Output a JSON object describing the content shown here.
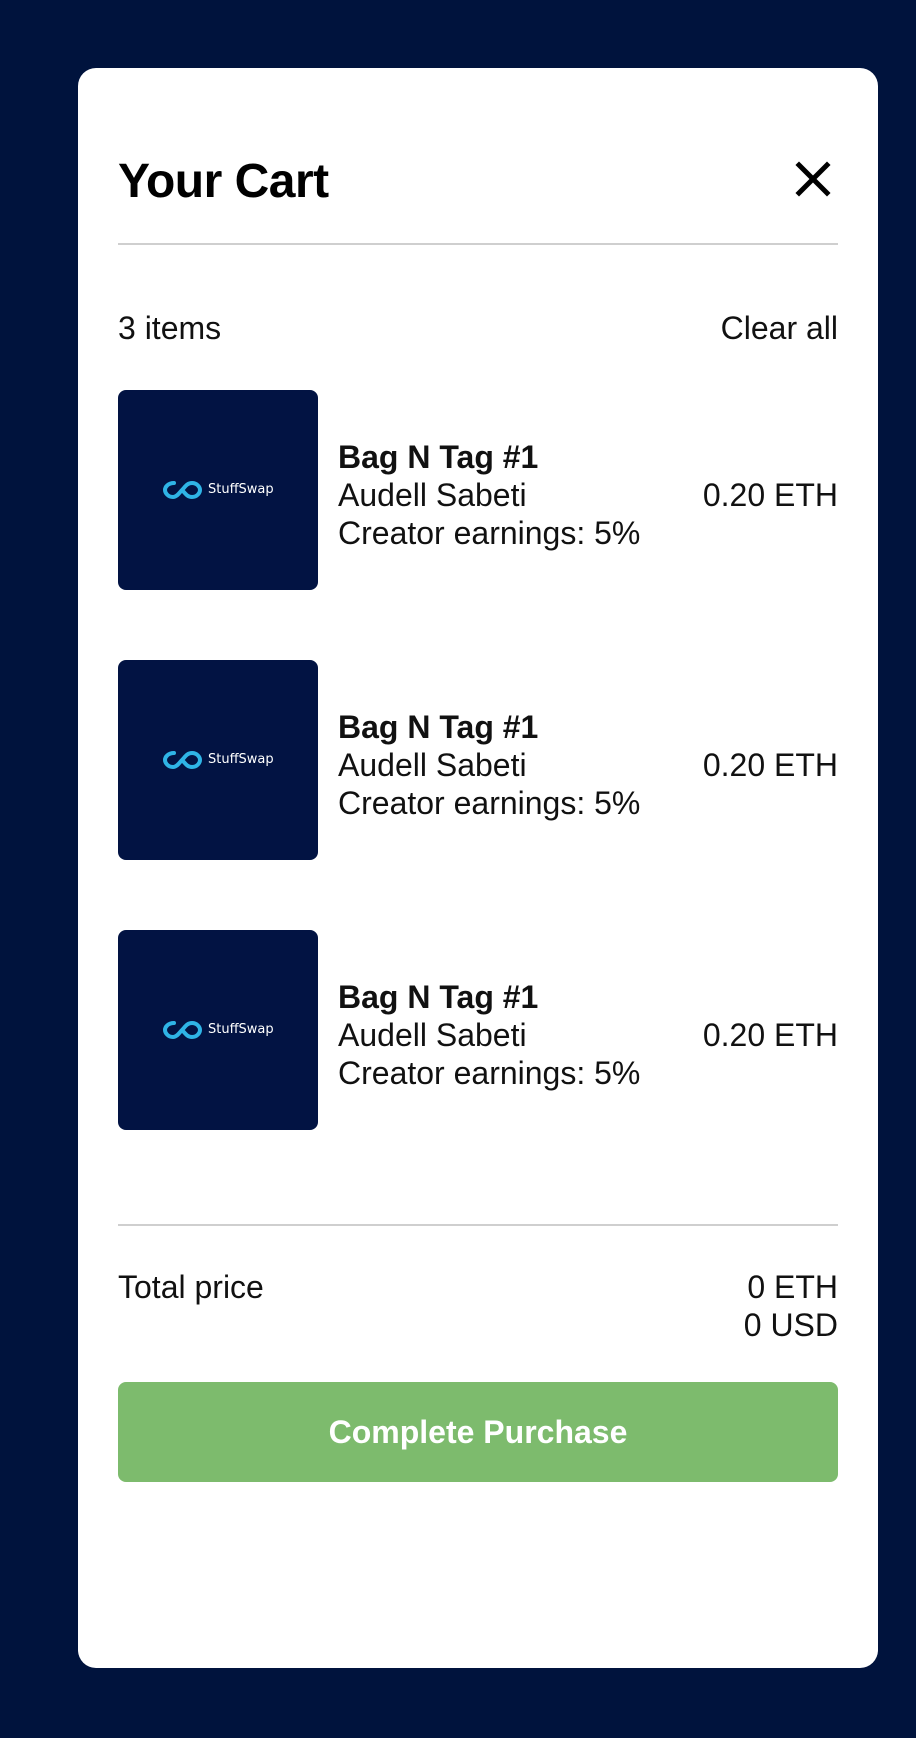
{
  "cart": {
    "title": "Your Cart",
    "close_label": "close",
    "item_count": "3 items",
    "clear_all": "Clear all",
    "items": [
      {
        "name": "Bag N Tag #1",
        "creator": "Audell Sabeti",
        "earnings": "Creator earnings: 5%",
        "price": "0.20 ETH",
        "logo_text": "StuffSwap"
      },
      {
        "name": "Bag N Tag #1",
        "creator": "Audell Sabeti",
        "earnings": "Creator earnings: 5%",
        "price": "0.20 ETH",
        "logo_text": "StuffSwap"
      },
      {
        "name": "Bag N Tag #1",
        "creator": "Audell Sabeti",
        "earnings": "Creator earnings: 5%",
        "price": "0.20 ETH",
        "logo_text": "StuffSwap"
      }
    ],
    "total_label": "Total price",
    "total_eth": "0 ETH",
    "total_usd": "0 USD",
    "purchase_button": "Complete Purchase"
  },
  "colors": {
    "page_background": "#00133d",
    "thumb_background": "#021343",
    "logo_accent": "#2fb4e6",
    "purchase_button": "#7dbb6d"
  },
  "icons": {
    "close": "close-icon",
    "logo": "stuffswap-logo-icon"
  }
}
